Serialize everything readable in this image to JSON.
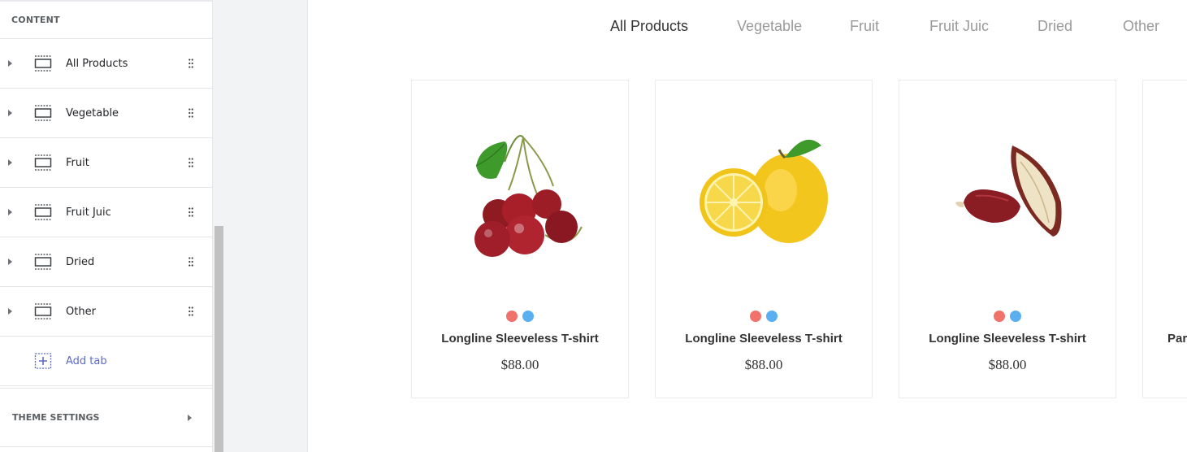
{
  "sidebar": {
    "content_heading": "CONTENT",
    "tabs": [
      {
        "label": "All Products"
      },
      {
        "label": "Vegetable"
      },
      {
        "label": "Fruit"
      },
      {
        "label": "Fruit Juic"
      },
      {
        "label": "Dried"
      },
      {
        "label": "Other"
      }
    ],
    "add_tab_label": "Add tab",
    "theme_settings_label": "THEME SETTINGS"
  },
  "preview": {
    "category_tabs": [
      {
        "label": "All Products",
        "active": true
      },
      {
        "label": "Vegetable",
        "active": false
      },
      {
        "label": "Fruit",
        "active": false
      },
      {
        "label": "Fruit Juic",
        "active": false
      },
      {
        "label": "Dried",
        "active": false
      },
      {
        "label": "Other",
        "active": false
      }
    ],
    "products": [
      {
        "image": "cherries",
        "title": "Longline Sleeveless T-shirt",
        "price": "$88.00",
        "swatch_colors": [
          "#f0726a",
          "#5aaff0"
        ]
      },
      {
        "image": "lemon",
        "title": "Longline Sleeveless T-shirt",
        "price": "$88.00",
        "swatch_colors": [
          "#f0726a",
          "#5aaff0"
        ]
      },
      {
        "image": "dried-fig",
        "title": "Longline Sleeveless T-shirt",
        "price": "$88.00",
        "swatch_colors": [
          "#f0726a",
          "#5aaff0"
        ]
      },
      {
        "title_partial": "Par"
      }
    ]
  },
  "colors": {
    "accent_link": "#5c6ac4",
    "active_tab": "#333333",
    "inactive_tab": "#9a9a9a"
  }
}
